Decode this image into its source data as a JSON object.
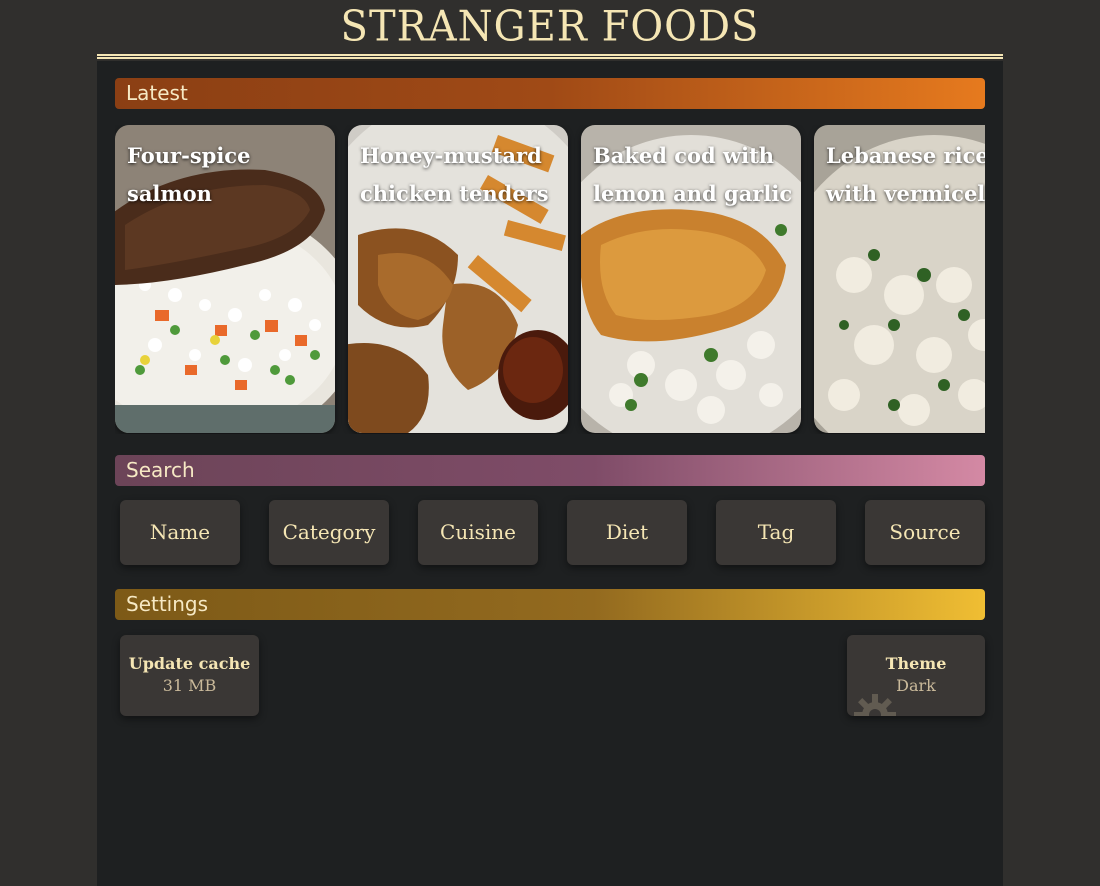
{
  "site": {
    "title": "STRANGER FOODS"
  },
  "sections": {
    "latest": "Latest",
    "search": "Search",
    "settings": "Settings"
  },
  "latest": [
    {
      "title": "Four-spice\nsalmon"
    },
    {
      "title": "Honey-mustard\nchicken tenders"
    },
    {
      "title": "Baked cod with\nlemon and garlic"
    },
    {
      "title": "Lebanese rice\nwith vermicelli"
    }
  ],
  "search": {
    "buttons": [
      "Name",
      "Category",
      "Cuisine",
      "Diet",
      "Tag",
      "Source"
    ]
  },
  "settings": {
    "update_cache": {
      "label": "Update cache",
      "value": "31 MB"
    },
    "theme": {
      "label": "Theme",
      "value": "Dark",
      "icon": "gear-icon"
    }
  },
  "colors": {
    "page_bg": "#302f2d",
    "main_bg": "#1e2021",
    "accent_text": "#f5e6b4",
    "latest_bar": "#e67a1e",
    "search_bar": "#d489a4",
    "settings_bar": "#f0be33"
  }
}
